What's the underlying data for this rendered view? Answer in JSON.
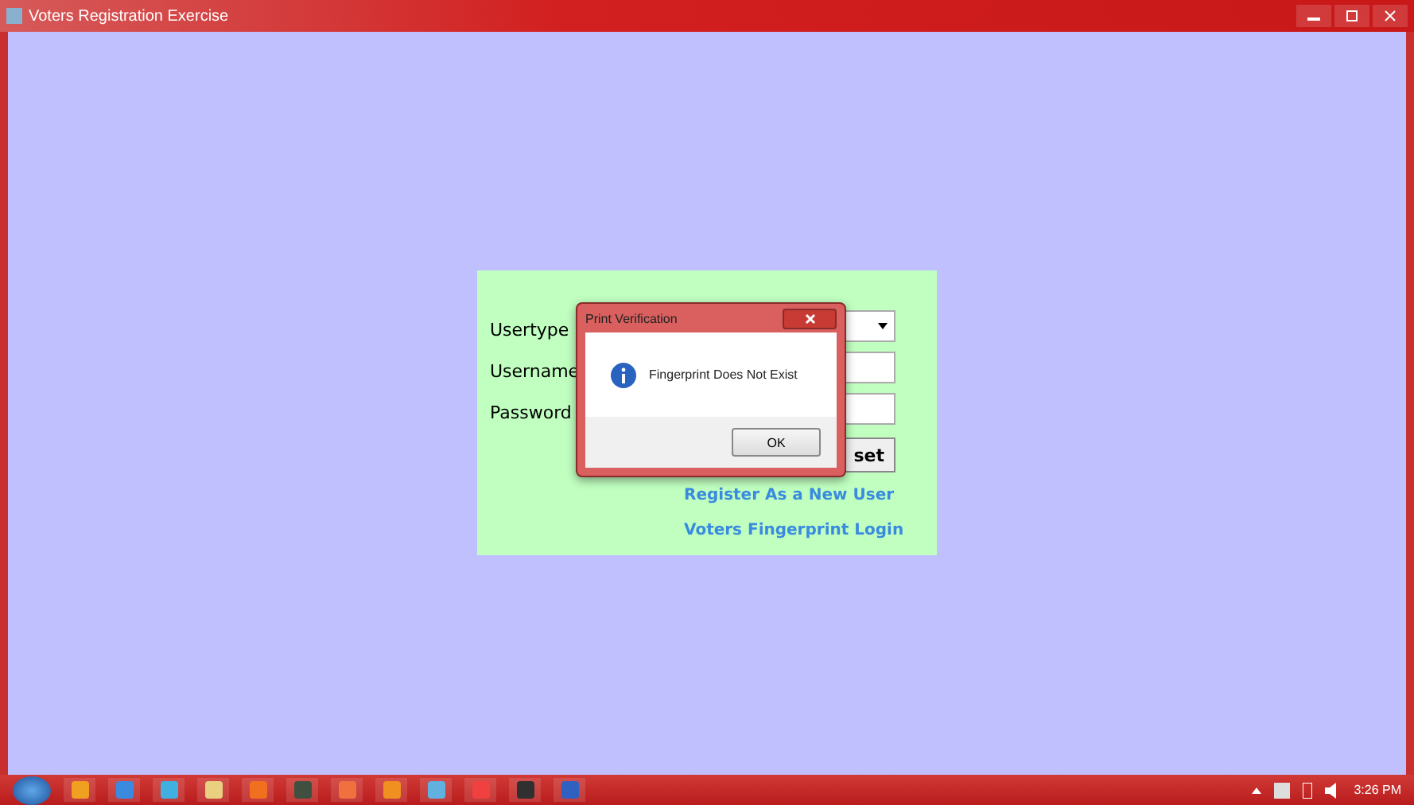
{
  "window": {
    "title": "Voters Registration Exercise"
  },
  "form": {
    "fields": [
      {
        "kind": "select",
        "label": "Usertype"
      },
      {
        "kind": "text",
        "label": "Username"
      },
      {
        "kind": "password",
        "label": "Password"
      }
    ],
    "reset_button": "set",
    "links": [
      "Register As a New User",
      "Voters Fingerprint Login"
    ]
  },
  "dialog": {
    "title": "Print Verification",
    "message": "Fingerprint Does Not Exist",
    "ok_button": "OK"
  },
  "taskbar": {
    "time": "3:26 PM"
  }
}
